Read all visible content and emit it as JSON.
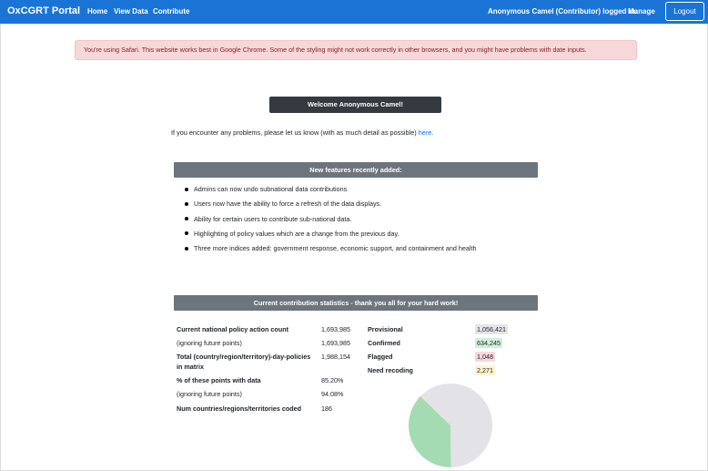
{
  "navbar": {
    "brand": "OxCGRT Portal",
    "links": [
      "Home",
      "View Data",
      "Contribute"
    ],
    "user_status": "Anonymous Camel (Contributor) logged in.",
    "manage": "Manage",
    "logout": "Logout"
  },
  "alert": {
    "text": "You're using Safari. This website works best in Google Chrome. Some of the styling might not work correctly in other browsers, and you might have problems with date inputs."
  },
  "welcome": {
    "title": "Welcome Anonymous Camel!",
    "problem_text": "If you encounter any problems, please let us know (with as much detail as possible)",
    "problem_link": "here."
  },
  "features": {
    "header": "New features recently added:",
    "items": [
      "Admins can now undo subnational data contributions",
      "Users now have the ability to force a refresh of the data displays.",
      "Ability for certain users to contribute sub-national data.",
      "Highlighting of policy values which are a change from the previous day.",
      "Three more indices added: government response, economic support, and containment and health"
    ]
  },
  "stats": {
    "header": "Current contribution statistics - thank you all for your hard work!",
    "left": [
      {
        "label": "Current national policy action count",
        "value": "1,693,985"
      },
      {
        "label": "(ignoring future points)",
        "value": "1,693,985"
      },
      {
        "label": "Total (country/region/territory)-day-policies",
        "label2": "in matrix",
        "value": "1,988,154"
      },
      {
        "label": "% of these points with data",
        "value": "85.20%"
      },
      {
        "label": "(ignoring future points)",
        "value": "94.08%"
      },
      {
        "label": "Num countries/regions/territories coded",
        "value": "186"
      }
    ],
    "right": [
      {
        "label": "Provisional",
        "value": "1,056,421",
        "color": "#e6e6ea"
      },
      {
        "label": "Confirmed",
        "value": "634,245",
        "color": "#a5dbb2"
      },
      {
        "label": "Flagged",
        "value": "1,048",
        "color": "#f1aeb5"
      },
      {
        "label": "Need recoding",
        "value": "2,271",
        "color": "#ffe69c"
      }
    ]
  },
  "colors": {
    "navbar": "#1a74d6",
    "pie_provisional": "#e2e2e7",
    "pie_confirmed": "#a5dbb2"
  }
}
